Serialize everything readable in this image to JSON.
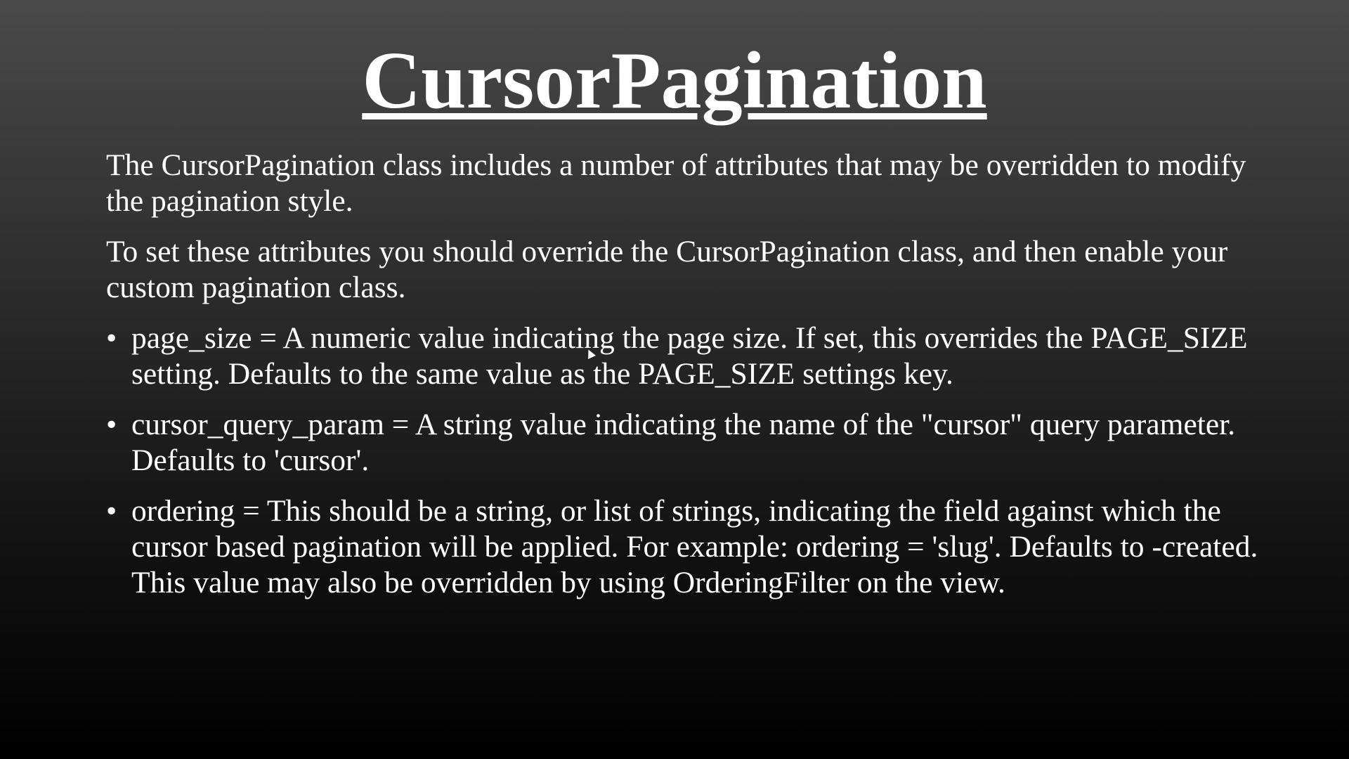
{
  "slide": {
    "title": "CursorPagination",
    "paragraphs": [
      "The CursorPagination class includes a number of attributes that may be overridden to modify the pagination style.",
      "To set these attributes you should override the CursorPagination class, and then enable your custom pagination class."
    ],
    "bullets": [
      "page_size = A numeric value indicating the page size. If set, this overrides the PAGE_SIZE setting. Defaults to the same value as the PAGE_SIZE settings key.",
      "cursor_query_param = A string value indicating the name of the \"cursor\" query parameter. Defaults to 'cursor'.",
      "ordering = This should be a string, or list of strings, indicating the field against which the cursor based pagination will be applied. For example: ordering = 'slug'. Defaults to -created. This value may also be overridden by using OrderingFilter on the view."
    ],
    "bullet_glyph": "•"
  },
  "colors": {
    "text": "#ffffff",
    "background_top": "#4a4a4a",
    "background_bottom": "#000000"
  },
  "icons": {
    "mouse_cursor": "arrow-pointer-icon"
  }
}
